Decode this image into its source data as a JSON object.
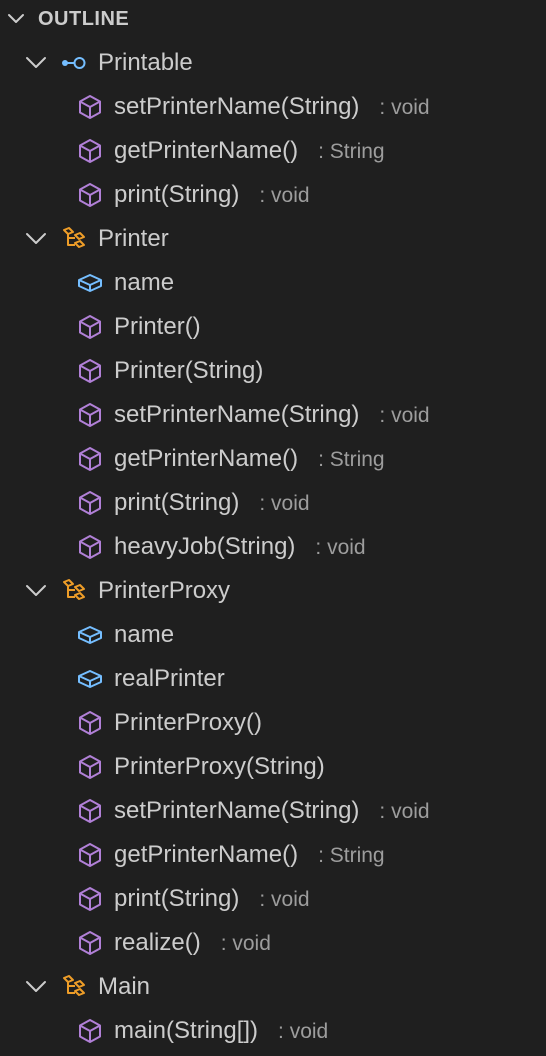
{
  "header": {
    "title": "OUTLINE"
  },
  "colors": {
    "background": "#1f1f1f",
    "text": "#cccccc",
    "detail": "#9d9d9d",
    "method": "#b180d7",
    "field": "#75beff",
    "class": "#ee9d28"
  },
  "items": [
    {
      "label": "Printable",
      "detail": "",
      "icon": "interface-icon",
      "level": 1
    },
    {
      "label": "setPrinterName(String)",
      "detail": ": void",
      "icon": "method-icon",
      "level": 2
    },
    {
      "label": "getPrinterName()",
      "detail": ": String",
      "icon": "method-icon",
      "level": 2
    },
    {
      "label": "print(String)",
      "detail": ": void",
      "icon": "method-icon",
      "level": 2
    },
    {
      "label": "Printer",
      "detail": "",
      "icon": "class-icon",
      "level": 1
    },
    {
      "label": "name",
      "detail": "",
      "icon": "field-icon",
      "level": 2
    },
    {
      "label": "Printer()",
      "detail": "",
      "icon": "method-icon",
      "level": 2
    },
    {
      "label": "Printer(String)",
      "detail": "",
      "icon": "method-icon",
      "level": 2
    },
    {
      "label": "setPrinterName(String)",
      "detail": ": void",
      "icon": "method-icon",
      "level": 2
    },
    {
      "label": "getPrinterName()",
      "detail": ": String",
      "icon": "method-icon",
      "level": 2
    },
    {
      "label": "print(String)",
      "detail": ": void",
      "icon": "method-icon",
      "level": 2
    },
    {
      "label": "heavyJob(String)",
      "detail": ": void",
      "icon": "method-icon",
      "level": 2
    },
    {
      "label": "PrinterProxy",
      "detail": "",
      "icon": "class-icon",
      "level": 1
    },
    {
      "label": "name",
      "detail": "",
      "icon": "field-icon",
      "level": 2
    },
    {
      "label": "realPrinter",
      "detail": "",
      "icon": "field-icon",
      "level": 2
    },
    {
      "label": "PrinterProxy()",
      "detail": "",
      "icon": "method-icon",
      "level": 2
    },
    {
      "label": "PrinterProxy(String)",
      "detail": "",
      "icon": "method-icon",
      "level": 2
    },
    {
      "label": "setPrinterName(String)",
      "detail": ": void",
      "icon": "method-icon",
      "level": 2
    },
    {
      "label": "getPrinterName()",
      "detail": ": String",
      "icon": "method-icon",
      "level": 2
    },
    {
      "label": "print(String)",
      "detail": ": void",
      "icon": "method-icon",
      "level": 2
    },
    {
      "label": "realize()",
      "detail": ": void",
      "icon": "method-icon",
      "level": 2
    },
    {
      "label": "Main",
      "detail": "",
      "icon": "class-icon",
      "level": 1
    },
    {
      "label": "main(String[])",
      "detail": ": void",
      "icon": "method-icon",
      "level": 2
    }
  ]
}
